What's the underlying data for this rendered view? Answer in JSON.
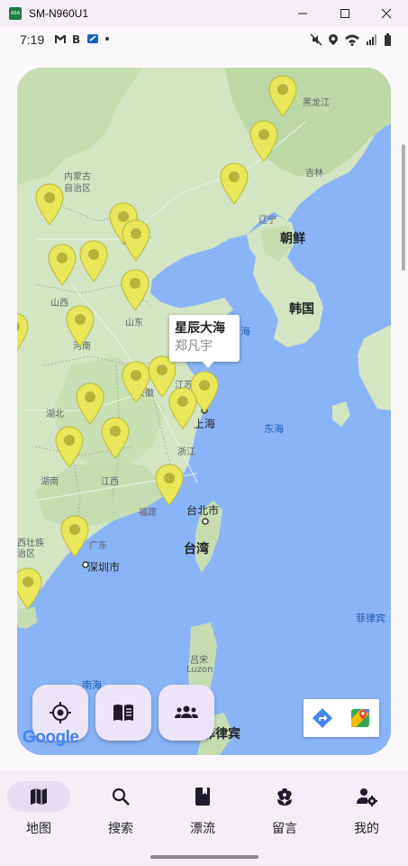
{
  "window": {
    "title": "SM-N960U1",
    "app_icon_text": "ASA"
  },
  "status_bar": {
    "time": "7:19"
  },
  "map": {
    "labels": [
      {
        "text": "黑龙江",
        "cls": "lbl-small"
      },
      {
        "text": "内蒙古",
        "cls": "lbl-small"
      },
      {
        "text": "自治区",
        "cls": "lbl-small"
      },
      {
        "text": "吉林",
        "cls": "lbl-small"
      },
      {
        "text": "辽宁",
        "cls": "lbl-small"
      },
      {
        "text": "朝鲜",
        "cls": "lbl-country"
      },
      {
        "text": "韩国",
        "cls": "lbl-country"
      },
      {
        "text": "山西",
        "cls": "lbl-small"
      },
      {
        "text": "山东",
        "cls": "lbl-small"
      },
      {
        "text": "河南",
        "cls": "lbl-small"
      },
      {
        "text": "江苏",
        "cls": "lbl-small"
      },
      {
        "text": "湖北",
        "cls": "lbl-small"
      },
      {
        "text": "安徽",
        "cls": "lbl-small"
      },
      {
        "text": "上海",
        "cls": "lbl-city"
      },
      {
        "text": "东海",
        "cls": "lbl-sea"
      },
      {
        "text": "浙江",
        "cls": "lbl-small"
      },
      {
        "text": "湖南",
        "cls": "lbl-small"
      },
      {
        "text": "江西",
        "cls": "lbl-small"
      },
      {
        "text": "福建",
        "cls": "lbl-small"
      },
      {
        "text": "台北市",
        "cls": "lbl-city"
      },
      {
        "text": "台湾",
        "cls": "lbl-country"
      },
      {
        "text": "西壮族",
        "cls": "lbl-small"
      },
      {
        "text": "治区",
        "cls": "lbl-small"
      },
      {
        "text": "广东",
        "cls": "lbl-small"
      },
      {
        "text": "深圳市",
        "cls": "lbl-city"
      },
      {
        "text": "菲律宾",
        "cls": "lbl-sea"
      },
      {
        "text": "吕宋",
        "cls": "lbl-small"
      },
      {
        "text": "Luzon",
        "cls": "lbl-small"
      },
      {
        "text": "南海",
        "cls": "lbl-sea"
      },
      {
        "text": "菲律宾",
        "cls": "lbl-country"
      },
      {
        "text": "海",
        "cls": "lbl-sea"
      }
    ],
    "info_window": {
      "title": "星辰大海",
      "subtitle": "郑凡宇"
    },
    "google_logo": "Google"
  },
  "bottom_nav": {
    "items": [
      {
        "label": "地图",
        "icon": "map-icon",
        "active": true
      },
      {
        "label": "搜索",
        "icon": "search-icon",
        "active": false
      },
      {
        "label": "漂流",
        "icon": "book-icon",
        "active": false
      },
      {
        "label": "留言",
        "icon": "flower-icon",
        "active": false
      },
      {
        "label": "我的",
        "icon": "person-settings-icon",
        "active": false
      }
    ]
  },
  "colors": {
    "marker": "#e8e85a",
    "sea": "#8ab4f8",
    "land": "#dbe9cf",
    "accent": "#e6ddf2"
  }
}
